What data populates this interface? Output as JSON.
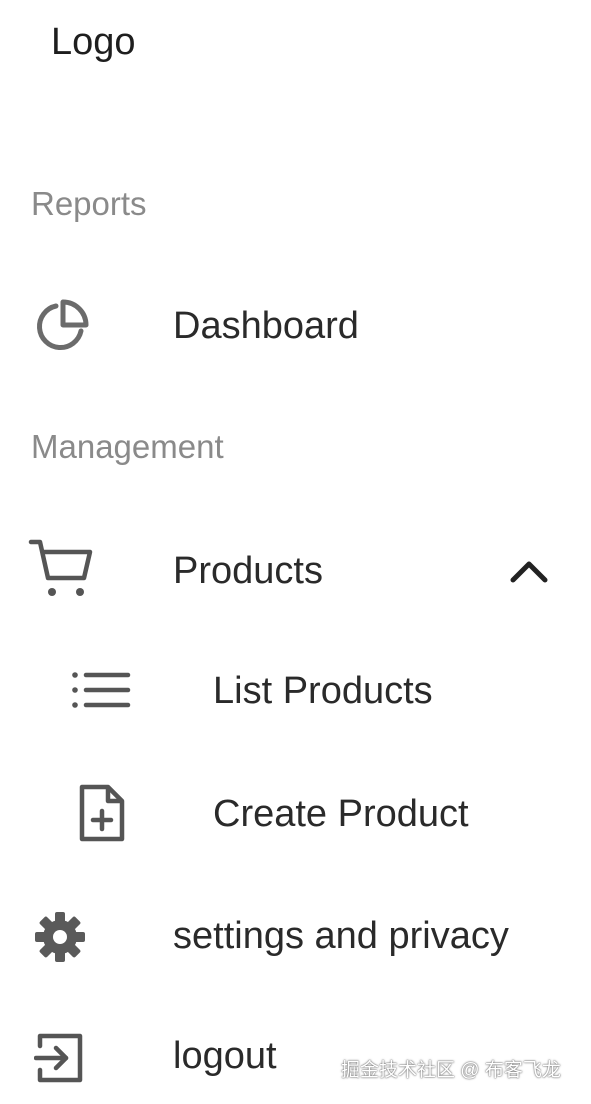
{
  "logo": {
    "text": "Logo"
  },
  "sections": {
    "reports": "Reports",
    "management": "Management"
  },
  "nav": {
    "dashboard": {
      "label": "Dashboard",
      "icon": "pie-chart-icon"
    },
    "products": {
      "label": "Products",
      "icon": "cart-icon",
      "expanded": true,
      "toggle_icon": "chevron-up-icon"
    },
    "list_products": {
      "label": "List Products",
      "icon": "list-icon"
    },
    "create_product": {
      "label": "Create Product",
      "icon": "file-add-icon"
    },
    "settings": {
      "label": "settings and privacy",
      "icon": "gear-icon"
    },
    "logout": {
      "label": "logout",
      "icon": "login-icon"
    }
  },
  "watermark": {
    "text": "掘金技术社区 @ 布客飞龙"
  }
}
